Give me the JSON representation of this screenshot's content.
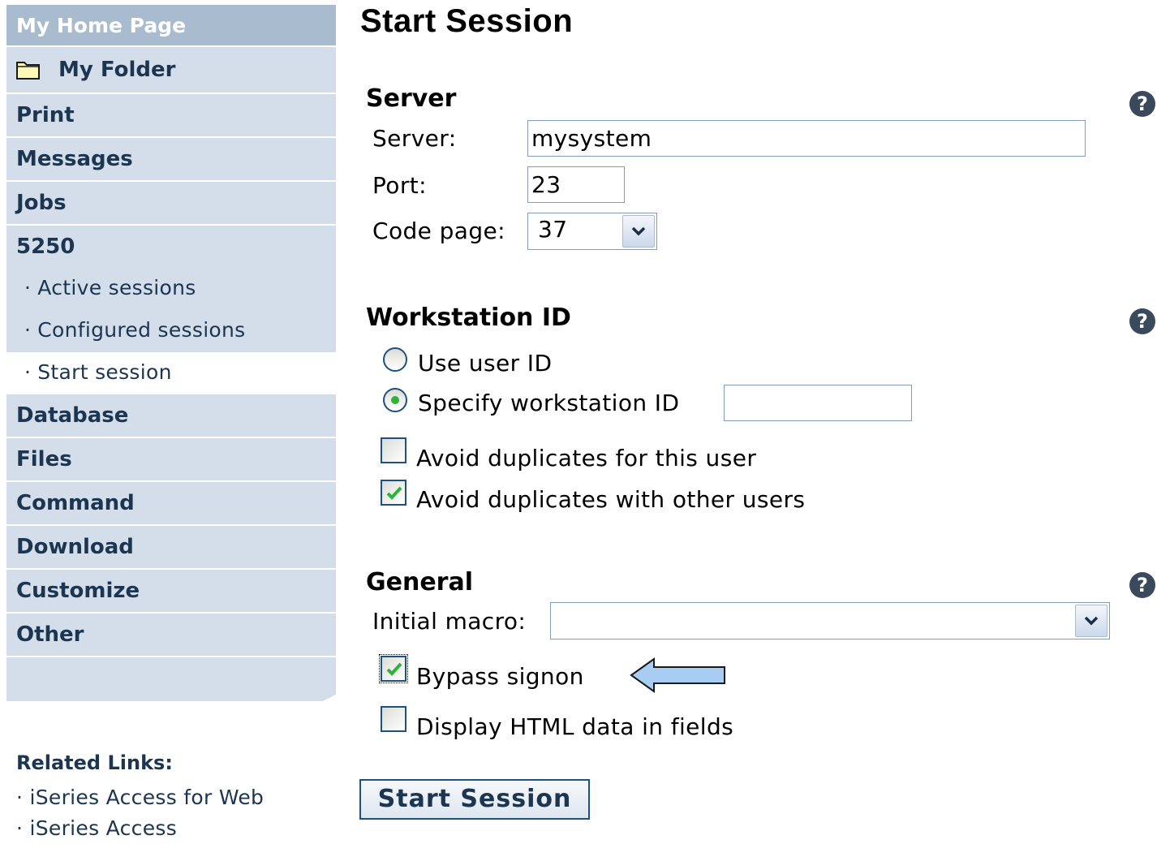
{
  "sidebar": {
    "home": "My Home Page",
    "folder": "My Folder",
    "items_top": [
      "Print",
      "Messages",
      "Jobs",
      "5250"
    ],
    "subitems": [
      "Active sessions",
      "Configured sessions",
      "Start session"
    ],
    "items_bottom": [
      "Database",
      "Files",
      "Command",
      "Download",
      "Customize",
      "Other"
    ],
    "related_title": "Related Links:",
    "related_links": [
      "iSeries Access for Web",
      "iSeries Access"
    ]
  },
  "main": {
    "title": "Start Session",
    "server_section": {
      "title": "Server",
      "server_label": "Server:",
      "server_value": "mysystem",
      "port_label": "Port:",
      "port_value": "23",
      "codepage_label": "Code page:",
      "codepage_value": "37"
    },
    "workstation_section": {
      "title": "Workstation ID",
      "use_user_id": "Use user ID",
      "specify_ws": "Specify workstation ID",
      "ws_value": "",
      "avoid_dup_user": "Avoid duplicates for this user",
      "avoid_dup_other": "Avoid duplicates with other users",
      "avoid_dup_user_checked": false,
      "avoid_dup_other_checked": true,
      "selected_radio": "specify"
    },
    "general_section": {
      "title": "General",
      "macro_label": "Initial macro:",
      "macro_value": "",
      "bypass_signon": "Bypass signon",
      "bypass_checked": true,
      "display_html": "Display HTML data in fields",
      "display_html_checked": false
    },
    "submit": "Start Session",
    "help_glyph": "?"
  },
  "colors": {
    "nav_bg": "#d3deea",
    "nav_home_bg": "#a9bccf",
    "nav_text": "#1c3550",
    "arrow_fill": "#a9cdf2",
    "check_green": "#2bb33a"
  },
  "icons": [
    "folder-icon",
    "help-icon",
    "checkmark-icon",
    "dropdown-arrow-icon",
    "pointer-arrow-icon"
  ]
}
